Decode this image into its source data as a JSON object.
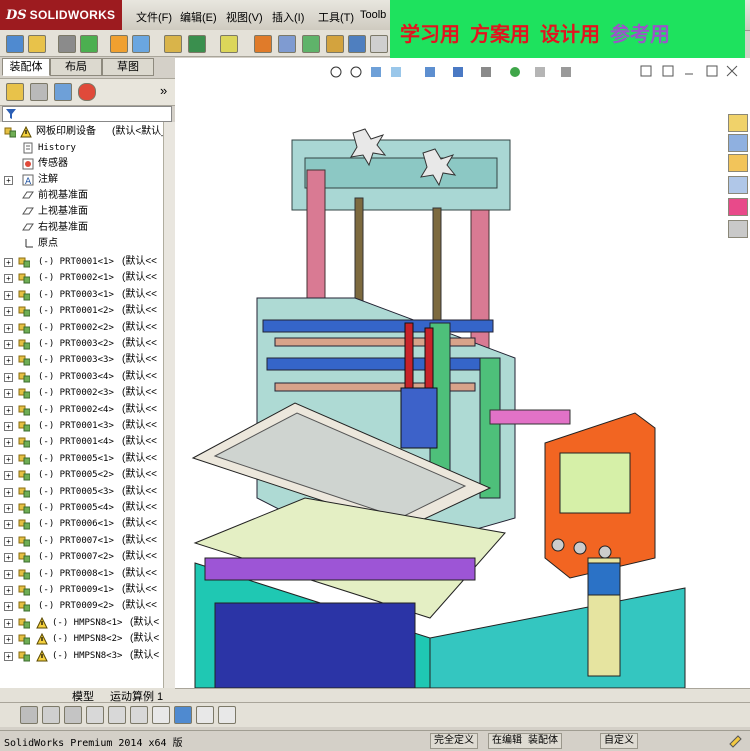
{
  "app": {
    "logo_mark": "DS",
    "logo_text": "SOLIDWORKS",
    "menus": [
      "文件(F)",
      "编辑(E)",
      "视图(V)",
      "插入(I)",
      "工具(T)",
      "Toolb"
    ]
  },
  "banner": {
    "items": [
      "学习用",
      "方案用",
      "设计用",
      "参考用"
    ]
  },
  "panel": {
    "tabs": [
      "装配体",
      "布局",
      "草图"
    ],
    "collapse": "»",
    "filter_icon": "filter-icon"
  },
  "tree": {
    "root": {
      "label": "网板印刷设备",
      "config": "(默认<默认_"
    },
    "fixed": [
      {
        "label": "History",
        "mono": true
      },
      {
        "label": "传感器",
        "mono": false
      },
      {
        "label": "注解",
        "mono": false
      },
      {
        "label": "前视基准面",
        "mono": false
      },
      {
        "label": "上视基准面",
        "mono": false
      },
      {
        "label": "右视基准面",
        "mono": false
      },
      {
        "label": "原点",
        "mono": false
      }
    ],
    "parts": [
      {
        "label": "(-) PRT0001<1>",
        "config": "(默认<<"
      },
      {
        "label": "(-) PRT0002<1>",
        "config": "(默认<<"
      },
      {
        "label": "(-) PRT0003<1>",
        "config": "(默认<<"
      },
      {
        "label": "(-) PRT0001<2>",
        "config": "(默认<<"
      },
      {
        "label": "(-) PRT0002<2>",
        "config": "(默认<<"
      },
      {
        "label": "(-) PRT0003<2>",
        "config": "(默认<<"
      },
      {
        "label": "(-) PRT0003<3>",
        "config": "(默认<<"
      },
      {
        "label": "(-) PRT0003<4>",
        "config": "(默认<<"
      },
      {
        "label": "(-) PRT0002<3>",
        "config": "(默认<<"
      },
      {
        "label": "(-) PRT0002<4>",
        "config": "(默认<<"
      },
      {
        "label": "(-) PRT0001<3>",
        "config": "(默认<<"
      },
      {
        "label": "(-) PRT0001<4>",
        "config": "(默认<<"
      },
      {
        "label": "(-) PRT0005<1>",
        "config": "(默认<<"
      },
      {
        "label": "(-) PRT0005<2>",
        "config": "(默认<<"
      },
      {
        "label": "(-) PRT0005<3>",
        "config": "(默认<<"
      },
      {
        "label": "(-) PRT0005<4>",
        "config": "(默认<<"
      },
      {
        "label": "(-) PRT0006<1>",
        "config": "(默认<<"
      },
      {
        "label": "(-) PRT0007<1>",
        "config": "(默认<<"
      },
      {
        "label": "(-) PRT0007<2>",
        "config": "(默认<<"
      },
      {
        "label": "(-) PRT0008<1>",
        "config": "(默认<<"
      },
      {
        "label": "(-) PRT0009<1>",
        "config": "(默认<<"
      },
      {
        "label": "(-) PRT0009<2>",
        "config": "(默认<<"
      },
      {
        "label": "(-) HMPSN8<1>",
        "config": "(默认<"
      },
      {
        "label": "(-) HMPSN8<2>",
        "config": "(默认<"
      },
      {
        "label": "(-) HMPSN8<3>",
        "config": "(默认<"
      }
    ]
  },
  "bottom_tabs": [
    "模型",
    "运动算例 1"
  ],
  "status": {
    "app_version": "SolidWorks Premium 2014 x64 版",
    "fields": [
      "完全定义",
      "在编辑 装配体",
      "自定义"
    ],
    "help_icon": "help-icon"
  },
  "colors": {
    "logo_red": "#9d1b1f",
    "banner_green": "#1ee25e",
    "banner_red": "#e2141f",
    "banner_purple": "#9a55c8"
  }
}
